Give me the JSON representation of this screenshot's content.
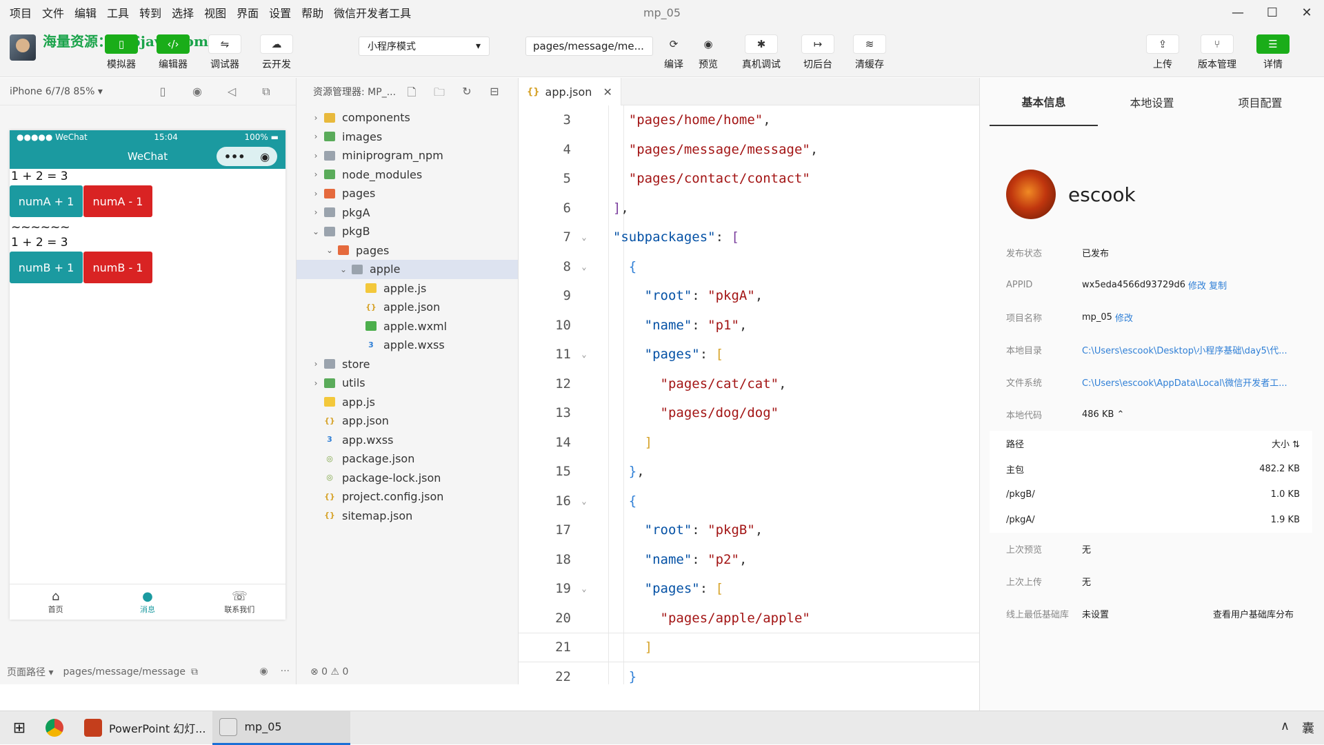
{
  "menu": {
    "items": [
      "项目",
      "文件",
      "编辑",
      "工具",
      "转到",
      "选择",
      "视图",
      "界面",
      "设置",
      "帮助",
      "微信开发者工具"
    ],
    "title": "mp_05"
  },
  "window_controls": {
    "minimize": "—",
    "maximize": "☐",
    "close": "✕"
  },
  "toolbar": {
    "watermark": "海量资源：666java.com",
    "simulator": "模拟器",
    "editor": "编辑器",
    "debugger": "调试器",
    "cloud": "云开发",
    "mode": "小程序模式",
    "page_path": "pages/message/me...",
    "compile": "编译",
    "preview": "预览",
    "real_debug": "真机调试",
    "backstage": "切后台",
    "clear_cache": "清缓存",
    "upload": "上传",
    "version": "版本管理",
    "details": "详情"
  },
  "simulator": {
    "device": "iPhone 6/7/8 85%",
    "status_left": "●●●●● WeChat",
    "status_time": "15:04",
    "status_battery": "100%",
    "nav_title": "WeChat",
    "line1": "1 + 2 = 3",
    "btn_a_plus": "numA + 1",
    "btn_a_minus": "numA - 1",
    "divider": "~~~~~~",
    "line2": "1 + 2 = 3",
    "btn_b_plus": "numB + 1",
    "btn_b_minus": "numB - 1",
    "tabs": [
      {
        "label": "首页",
        "icon": "⌂"
      },
      {
        "label": "消息",
        "icon": "●"
      },
      {
        "label": "联系我们",
        "icon": "☏"
      }
    ],
    "footer_label": "页面路径",
    "footer_path": "pages/message/message"
  },
  "explorer": {
    "title": "资源管理器: MP_...",
    "status": "⊗ 0 ⚠ 0",
    "tree": [
      {
        "name": "components",
        "arrow": "›",
        "indent": 0,
        "icon": "folder-y"
      },
      {
        "name": "images",
        "arrow": "›",
        "indent": 0,
        "icon": "folder-g"
      },
      {
        "name": "miniprogram_npm",
        "arrow": "›",
        "indent": 0,
        "icon": "folder"
      },
      {
        "name": "node_modules",
        "arrow": "›",
        "indent": 0,
        "icon": "folder-g"
      },
      {
        "name": "pages",
        "arrow": "›",
        "indent": 0,
        "icon": "folder-o"
      },
      {
        "name": "pkgA",
        "arrow": "›",
        "indent": 0,
        "icon": "folder"
      },
      {
        "name": "pkgB",
        "arrow": "⌄",
        "indent": 0,
        "icon": "folder"
      },
      {
        "name": "pages",
        "arrow": "⌄",
        "indent": 1,
        "icon": "folder-o"
      },
      {
        "name": "apple",
        "arrow": "⌄",
        "indent": 2,
        "icon": "folder",
        "selected": true
      },
      {
        "name": "apple.js",
        "arrow": "",
        "indent": 3,
        "icon": "js"
      },
      {
        "name": "apple.json",
        "arrow": "",
        "indent": 3,
        "icon": "json"
      },
      {
        "name": "apple.wxml",
        "arrow": "",
        "indent": 3,
        "icon": "wxml"
      },
      {
        "name": "apple.wxss",
        "arrow": "",
        "indent": 3,
        "icon": "wxss"
      },
      {
        "name": "store",
        "arrow": "›",
        "indent": 0,
        "icon": "folder"
      },
      {
        "name": "utils",
        "arrow": "›",
        "indent": 0,
        "icon": "folder-g"
      },
      {
        "name": "app.js",
        "arrow": "",
        "indent": 0,
        "icon": "js"
      },
      {
        "name": "app.json",
        "arrow": "",
        "indent": 0,
        "icon": "json"
      },
      {
        "name": "app.wxss",
        "arrow": "",
        "indent": 0,
        "icon": "wxss"
      },
      {
        "name": "package.json",
        "arrow": "",
        "indent": 0,
        "icon": "pkg"
      },
      {
        "name": "package-lock.json",
        "arrow": "",
        "indent": 0,
        "icon": "pkg"
      },
      {
        "name": "project.config.json",
        "arrow": "",
        "indent": 0,
        "icon": "json"
      },
      {
        "name": "sitemap.json",
        "arrow": "",
        "indent": 0,
        "icon": "json"
      }
    ]
  },
  "editor": {
    "tab": "app.json",
    "lines": [
      {
        "n": "3",
        "fold": "",
        "html": "    <span class='s'>\"pages/home/home\"</span><span class='p'>,</span>"
      },
      {
        "n": "4",
        "fold": "",
        "html": "    <span class='s'>\"pages/message/message\"</span><span class='p'>,</span>"
      },
      {
        "n": "5",
        "fold": "",
        "html": "    <span class='s'>\"pages/contact/contact\"</span>"
      },
      {
        "n": "6",
        "fold": "",
        "html": "  <span class='b2'>]</span><span class='p'>,</span>"
      },
      {
        "n": "7",
        "fold": "⌄",
        "html": "  <span class='k'>\"subpackages\"</span><span class='p'>: </span><span class='b2'>[</span>"
      },
      {
        "n": "8",
        "fold": "⌄",
        "html": "    <span class='b3'>{</span>"
      },
      {
        "n": "9",
        "fold": "",
        "html": "      <span class='k'>\"root\"</span><span class='p'>: </span><span class='s'>\"pkgA\"</span><span class='p'>,</span>"
      },
      {
        "n": "10",
        "fold": "",
        "html": "      <span class='k'>\"name\"</span><span class='p'>: </span><span class='s'>\"p1\"</span><span class='p'>,</span>"
      },
      {
        "n": "11",
        "fold": "⌄",
        "html": "      <span class='k'>\"pages\"</span><span class='p'>: </span><span class='b1'>[</span>"
      },
      {
        "n": "12",
        "fold": "",
        "html": "        <span class='s'>\"pages/cat/cat\"</span><span class='p'>,</span>"
      },
      {
        "n": "13",
        "fold": "",
        "html": "        <span class='s'>\"pages/dog/dog\"</span>"
      },
      {
        "n": "14",
        "fold": "",
        "html": "      <span class='b1'>]</span>"
      },
      {
        "n": "15",
        "fold": "",
        "html": "    <span class='b3'>}</span><span class='p'>,</span>"
      },
      {
        "n": "16",
        "fold": "⌄",
        "html": "    <span class='b3'>{</span>"
      },
      {
        "n": "17",
        "fold": "",
        "html": "      <span class='k'>\"root\"</span><span class='p'>: </span><span class='s'>\"pkgB\"</span><span class='p'>,</span>"
      },
      {
        "n": "18",
        "fold": "",
        "html": "      <span class='k'>\"name\"</span><span class='p'>: </span><span class='s'>\"p2\"</span><span class='p'>,</span>"
      },
      {
        "n": "19",
        "fold": "⌄",
        "html": "      <span class='k'>\"pages\"</span><span class='p'>: </span><span class='b1'>[</span>"
      },
      {
        "n": "20",
        "fold": "",
        "html": "        <span class='s'>\"pages/apple/apple\"</span>"
      },
      {
        "n": "21",
        "fold": "",
        "html": "      <span class='b1'>]</span>",
        "current": true
      },
      {
        "n": "22",
        "fold": "",
        "html": "    <span class='b3'>}</span>"
      }
    ]
  },
  "details": {
    "tabs": [
      "基本信息",
      "本地设置",
      "项目配置"
    ],
    "username": "escook",
    "rows": [
      {
        "label": "发布状态",
        "value": "已发布",
        "link": ""
      },
      {
        "label": "APPID",
        "value": "wx5eda4566d93729d6",
        "link": "修改 复制"
      },
      {
        "label": "项目名称",
        "value": "mp_05",
        "link": "修改"
      },
      {
        "label": "本地目录",
        "value": "",
        "link": "C:\\Users\\escook\\Desktop\\小程序基础\\day5\\代..."
      },
      {
        "label": "文件系统",
        "value": "",
        "link": "C:\\Users\\escook\\AppData\\Local\\微信开发者工..."
      },
      {
        "label": "本地代码",
        "value": "486 KB ⌃",
        "link": ""
      }
    ],
    "size_header": {
      "path": "路径",
      "size": "大小 ⇅"
    },
    "sizes": [
      {
        "path": "主包",
        "size": "482.2 KB"
      },
      {
        "path": "/pkgB/",
        "size": "1.0 KB"
      },
      {
        "path": "/pkgA/",
        "size": "1.9 KB"
      }
    ],
    "last_preview_label": "上次预览",
    "last_preview": "无",
    "last_upload_label": "上次上传",
    "last_upload": "无",
    "min_lib_label": "线上最低基础库",
    "min_lib": "未设置",
    "min_lib_link": "查看用户基础库分布"
  },
  "taskbar": {
    "start": "⊞",
    "ppt": "PowerPoint 幻灯...",
    "app": "mp_05",
    "tray_up": "∧",
    "tray_ime": "囊"
  }
}
